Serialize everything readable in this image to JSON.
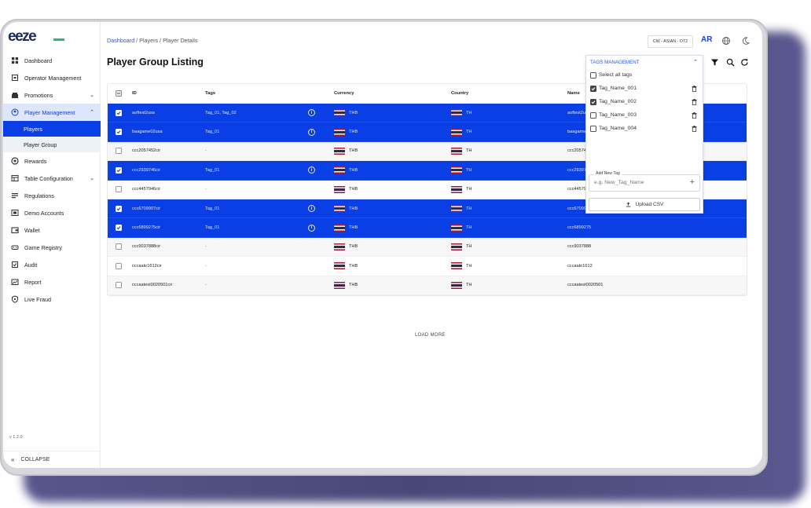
{
  "brand": {
    "logo_text": "eeze"
  },
  "sidebar": {
    "items": [
      {
        "label": "Dashboard",
        "icon": "grid-icon"
      },
      {
        "label": "Operator Management",
        "icon": "building-icon"
      },
      {
        "label": "Promotions",
        "icon": "gift-icon",
        "chevron": "down"
      },
      {
        "label": "Player Management",
        "icon": "user-circle-icon",
        "chevron": "up"
      },
      {
        "label": "Players",
        "sub": true,
        "current": true
      },
      {
        "label": "Player Group",
        "sub": true
      },
      {
        "label": "Rewards",
        "icon": "rewards-icon"
      },
      {
        "label": "Table Configuration",
        "icon": "table-icon",
        "chevron": "down"
      },
      {
        "label": "Regulations",
        "icon": "list-icon"
      },
      {
        "label": "Demo Accounts",
        "icon": "demo-icon"
      },
      {
        "label": "Wallet",
        "icon": "wallet-icon"
      },
      {
        "label": "Game Registry",
        "icon": "gamepad-icon"
      },
      {
        "label": "Audit",
        "icon": "audit-icon"
      },
      {
        "label": "Report",
        "icon": "report-icon"
      },
      {
        "label": "Live Fraud",
        "icon": "shield-icon"
      }
    ],
    "version": "v 1.2.0",
    "collapse_label": "COLLAPSE"
  },
  "breadcrumb": {
    "root": "Dashboard",
    "rest": " / Players / Player Details"
  },
  "page_title": "Player Group Listing",
  "header": {
    "env": "CW - ASIAN - OT2",
    "lang": "AR"
  },
  "table": {
    "columns": {
      "id": "ID",
      "tags": "Tags",
      "currency": "Currency",
      "country": "Country",
      "name": "Name"
    },
    "rows": [
      {
        "id": "aoftest2usa",
        "tags": "Tag_01, Tag_02",
        "info": true,
        "currency": "THB",
        "country": "TH",
        "name": "aoftest2usa",
        "selected": true
      },
      {
        "id": "baagame02usa",
        "tags": "Tag_01",
        "info": true,
        "currency": "THB",
        "country": "TH",
        "name": "baagame02usa",
        "selected": true
      },
      {
        "id": "ccc2057452cir",
        "tags": "-",
        "info": false,
        "currency": "THB",
        "country": "TH",
        "name": "ccc2057452",
        "selected": false
      },
      {
        "id": "ccc2939746cir",
        "tags": "Tag_01",
        "info": true,
        "currency": "THB",
        "country": "TH",
        "name": "ccc2939746",
        "selected": true
      },
      {
        "id": "ccc4457946cir",
        "tags": "-",
        "info": false,
        "currency": "THB",
        "country": "TH",
        "name": "ccc4457946",
        "selected": false
      },
      {
        "id": "ccc6709907cir",
        "tags": "Tag_01",
        "info": true,
        "currency": "THB",
        "country": "TH",
        "name": "ccc6709907",
        "selected": true
      },
      {
        "id": "ccc6899275cir",
        "tags": "Tag_01",
        "info": true,
        "currency": "THB",
        "country": "TH",
        "name": "ccc6899275",
        "selected": true
      },
      {
        "id": "ccc9037888cir",
        "tags": "-",
        "info": false,
        "currency": "THB",
        "country": "TH",
        "name": "ccc9037888",
        "selected": false
      },
      {
        "id": "cccaakr1612cir",
        "tags": "-",
        "info": false,
        "currency": "THB",
        "country": "TH",
        "name": "cccaakr1612",
        "selected": false
      },
      {
        "id": "cccaatest0020501cir",
        "tags": "-",
        "info": false,
        "currency": "THB",
        "country": "TH",
        "name": "cccaatest0020501",
        "selected": false
      }
    ]
  },
  "load_more": "LOAD MORE",
  "tags_panel": {
    "title": "TAGS MANAGEMENT",
    "select_all": "Select all tags",
    "tags": [
      {
        "name": "Tag_Name_001",
        "checked": true
      },
      {
        "name": "Tag_Name_002",
        "checked": true
      },
      {
        "name": "Tag_Name_003",
        "checked": false
      },
      {
        "name": "Tag_Name_004",
        "checked": false
      }
    ],
    "add_label": "Add New Tag",
    "add_placeholder": "e.g. New_Tag_Name",
    "upload_label": "Upload CSV"
  },
  "colors": {
    "accent": "#0a3fe6",
    "link": "#2b55e6"
  }
}
